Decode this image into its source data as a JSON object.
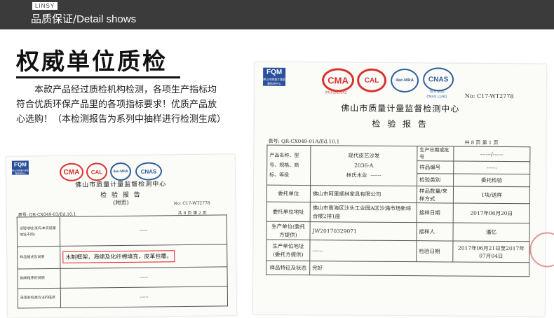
{
  "header": {
    "brand": "LINSY",
    "title_cn": "品质保证/",
    "title_en": "Detail shows"
  },
  "section": {
    "heading": "权威单位质检",
    "description": "本款产品经过质检机构检测，各项生产指标均符合优质环保产品里的各项指标要求！优质产品放心选购！（本检测报告为系列中抽样进行检测生成）"
  },
  "colors": {
    "header_bg": "#3b3b3b",
    "fqm_blue": "#2b4f9a",
    "cma_red": "#d9322f",
    "cnas_blue": "#2e5e9e",
    "highlight_red": "#e02020"
  },
  "cert_logos": {
    "fqm": "FQM",
    "fqm_sub": "佛山市质量计量监督检测中心",
    "cma": "CMA",
    "cma_number": "2015191324Z",
    "cal": "CAL",
    "ilac": "ilac-MRA",
    "cnas": "CNAS",
    "cnas_sub": "TESTING",
    "cnas_number": "CNAS L1461"
  },
  "left_doc": {
    "org": "佛山市质量计量监督检测中心",
    "title": "检 验 报 告",
    "subtitle": "(附页)",
    "report_no": "No: C17-WT2778",
    "form_no": "表号: QR-CX049-03/Ed.10.1",
    "page": "共 8 页 第 2 页",
    "rows": [
      {
        "label": "试验地址(如与本实验室地址不同)",
        "value": "------"
      },
      {
        "label": "样品描述及说明",
        "value": "木制框架，海绵及化纤棉填充，皮革包覆。"
      },
      {
        "label": "抽样程序的说明",
        "value": "------"
      },
      {
        "label": "采用非标准方法的描述",
        "value": "------"
      }
    ]
  },
  "right_doc": {
    "org": "佛山市质量计量监督检测中心",
    "title": "检 验 报 告",
    "report_no": "No: C17-WT2778",
    "form_no": "表号: QR-CX049-01A/Ed.10.1",
    "page": "共 8 页 第 1 页",
    "table": {
      "product_label": "产品名称、型号、规格、商标、等级",
      "product_name": "现代皮艺沙发",
      "product_model": "2036-A",
      "product_brand": "林氏木业",
      "product_grade": "------",
      "prod_date_label": "生产日期或批号",
      "prod_date_value": "------/------",
      "sample_no_label": "样品编号",
      "sample_no_value": "------",
      "test_type_label": "检验类别",
      "test_type_value": "委托检验",
      "client_label": "委托单位",
      "client_value": "佛山市阿里顺林家具有限公司",
      "qty_label": "样品数量/来样方式",
      "qty_value": "1块/送样",
      "client_addr_label": "委托单位地址",
      "client_addr_value": "佛山市南海区沙头工业园A区沙涌市场新综合楼2排1座",
      "receive_date_label": "接样日期",
      "receive_date_value": "2017年06月20日",
      "batch_label": "生产单位(委托方提供)",
      "batch_value": "JW20170329071",
      "receiver_label": "接样人",
      "receiver_value": "潘忆",
      "maker_addr_label": "生产单位地址(委托方提供)",
      "maker_addr_value": "------",
      "test_date_label": "检验日期",
      "test_date_value": "2017年06月21日至2017年07月04日",
      "feature_label": "样品特征及状态",
      "feature_value": "完好"
    }
  }
}
